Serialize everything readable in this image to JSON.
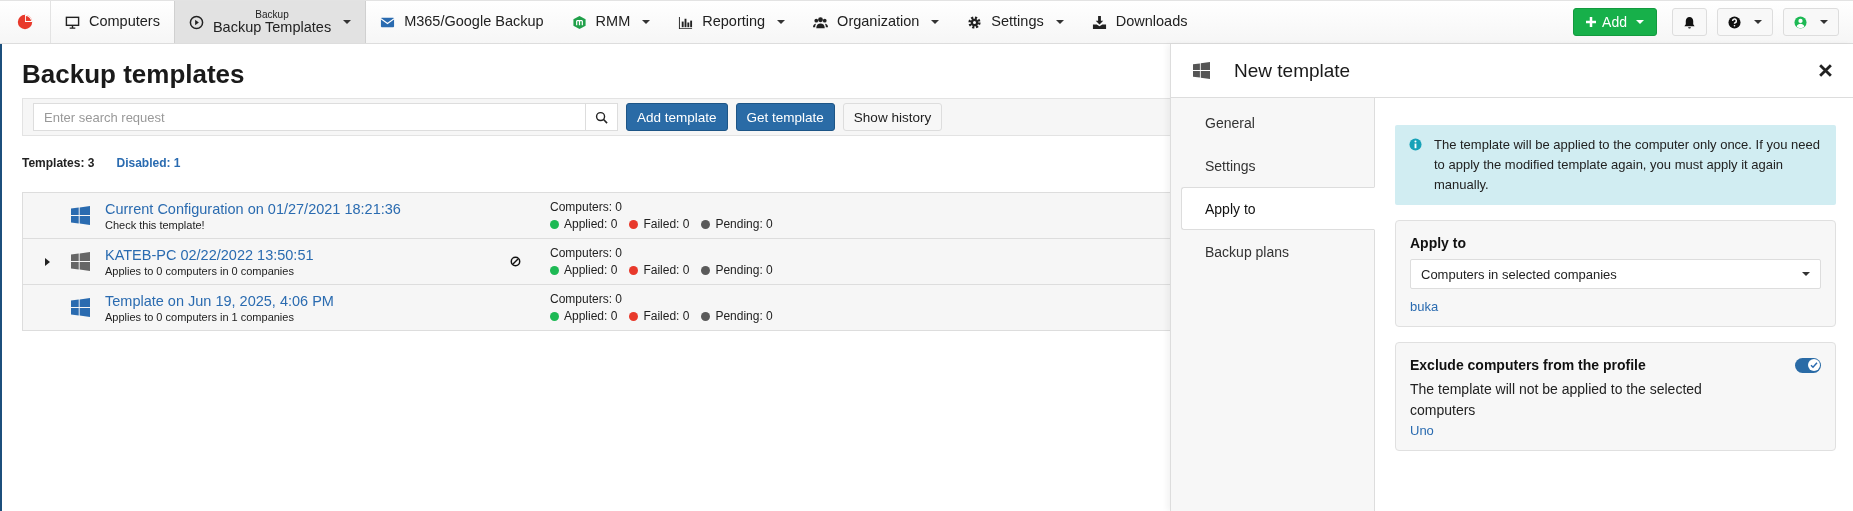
{
  "nav": {
    "items": [
      {
        "kind": "monitor",
        "label": "Computers",
        "dropdown": false,
        "selected": false
      },
      {
        "kind": "play",
        "sublabel": "Backup",
        "label": "Backup Templates",
        "dropdown": true,
        "selected": true
      },
      {
        "kind": "envelope",
        "label": "M365/Google Backup",
        "dropdown": false,
        "selected": false
      },
      {
        "kind": "cube",
        "label": "RMM",
        "dropdown": true,
        "selected": false
      },
      {
        "kind": "chart",
        "label": "Reporting",
        "dropdown": true,
        "selected": false
      },
      {
        "kind": "users",
        "label": "Organization",
        "dropdown": true,
        "selected": false
      },
      {
        "kind": "gear",
        "label": "Settings",
        "dropdown": true,
        "selected": false
      },
      {
        "kind": "download",
        "label": "Downloads",
        "dropdown": false,
        "selected": false
      }
    ],
    "add_button": "Add"
  },
  "page": {
    "title": "Backup templates",
    "search": {
      "placeholder": "Enter search request"
    },
    "buttons": [
      {
        "label": "Add template",
        "kind": "primary"
      },
      {
        "label": "Get template",
        "kind": "primary"
      },
      {
        "label": "Show history",
        "kind": "default"
      }
    ],
    "templates_count": "Templates: 3",
    "disabled_count": "Disabled: 1"
  },
  "rows": [
    {
      "title": "Current Configuration on 01/27/2021 18:21:36",
      "subtitle": "Check this template!",
      "expandable": false,
      "disabled": false,
      "computers": "Computers: 0",
      "statuses": [
        {
          "label": "Applied: 0",
          "color": "#1db954"
        },
        {
          "label": "Failed: 0",
          "color": "#e8392b"
        },
        {
          "label": "Pending: 0",
          "color": "#5a5a5a"
        }
      ]
    },
    {
      "title": "KATEB-PC 02/22/2022 13:50:51",
      "subtitle": "Applies to 0 computers in 0 companies",
      "expandable": true,
      "disabled": true,
      "computers": "Computers: 0",
      "statuses": [
        {
          "label": "Applied: 0",
          "color": "#1db954"
        },
        {
          "label": "Failed: 0",
          "color": "#e8392b"
        },
        {
          "label": "Pending: 0",
          "color": "#5a5a5a"
        }
      ]
    },
    {
      "title": "Template on Jun 19, 2025, 4:06 PM",
      "subtitle": "Applies to 0 computers in 1 companies",
      "expandable": false,
      "disabled": false,
      "computers": "Computers: 0",
      "statuses": [
        {
          "label": "Applied: 0",
          "color": "#1db954"
        },
        {
          "label": "Failed: 0",
          "color": "#e8392b"
        },
        {
          "label": "Pending: 0",
          "color": "#5a5a5a"
        }
      ]
    }
  ],
  "panel": {
    "title": "New template",
    "tabs": [
      {
        "label": "General",
        "selected": false
      },
      {
        "label": "Settings",
        "selected": false
      },
      {
        "label": "Apply to",
        "selected": true
      },
      {
        "label": "Backup plans",
        "selected": false
      }
    ],
    "info": "The template will be applied to the computer only once. If you need to apply the modified template again, you must apply it again manually.",
    "apply_to": {
      "label": "Apply to",
      "value": "Computers in selected companies",
      "links": [
        "buka"
      ]
    },
    "exclude": {
      "title": "Exclude computers from the profile",
      "description": "The template will not be applied to the selected computers",
      "on": true,
      "links": [
        "Uno"
      ]
    }
  }
}
